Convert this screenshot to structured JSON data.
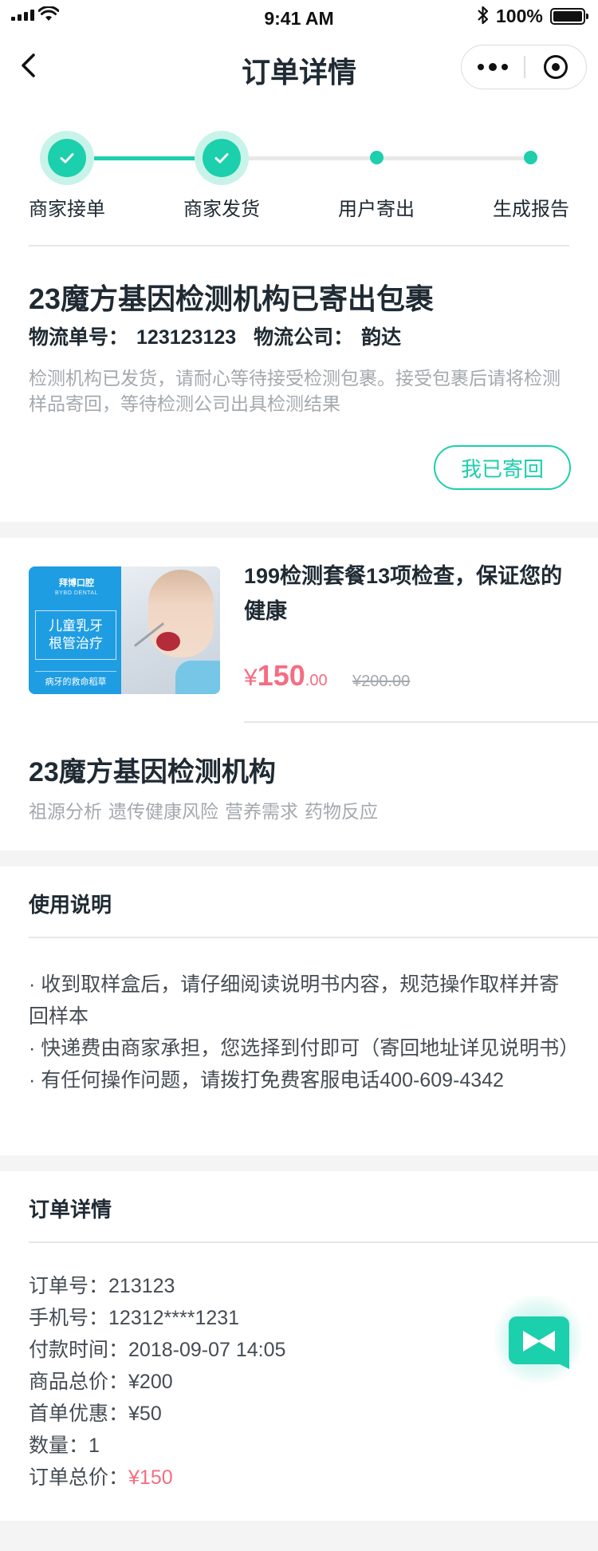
{
  "status_bar": {
    "time": "9:41 AM",
    "battery": "100%"
  },
  "nav": {
    "title": "订单详情"
  },
  "progress": {
    "steps": [
      {
        "label": "商家接单",
        "done": true
      },
      {
        "label": "商家发货",
        "done": true
      },
      {
        "label": "用户寄出",
        "done": false
      },
      {
        "label": "生成报告",
        "done": false
      }
    ]
  },
  "shipment": {
    "title": "23魔方基因检测机构已寄出包裹",
    "tracking_label": "物流单号：",
    "tracking_no": "123123123",
    "company_label": "物流公司：",
    "company": "韵达",
    "desc": "检测机构已发货，请耐心等待接受检测包裹。接受包裹后请将检测样品寄回，等待检测公司出具检测结果",
    "button": "我已寄回"
  },
  "product": {
    "thumb": {
      "brand": "拜博口腔",
      "brand_en": "BYBO DENTAL",
      "line1": "儿童乳牙",
      "line2": "根管治疗",
      "footer": "病牙的救命稻草"
    },
    "name": "199检测套餐13项检查，保证您的健康",
    "price_symbol": "¥",
    "price_int": "150",
    "price_dec": ".00",
    "price_old": "¥200.00"
  },
  "org": {
    "name": "23魔方基因检测机构",
    "tags": [
      "祖源分析",
      "遗传健康风险",
      "营养需求",
      "药物反应"
    ]
  },
  "usage": {
    "title": "使用说明",
    "items": [
      "· 收到取样盒后，请仔细阅读说明书内容，规范操作取样并寄回样本",
      "· 快递费由商家承担，您选择到付即可（寄回地址详见说明书）",
      "· 有任何操作问题，请拨打免费客服电话400-609-4342"
    ]
  },
  "order": {
    "title": "订单详情",
    "rows": [
      {
        "label": "订单号：",
        "value": "213123"
      },
      {
        "label": "手机号：",
        "value": "12312****1231"
      },
      {
        "label": "付款时间：",
        "value": "2018-09-07 14:05"
      },
      {
        "label": "商品总价：",
        "value": "¥200"
      },
      {
        "label": "首单优惠：",
        "value": "¥50"
      },
      {
        "label": "数量：",
        "value": "1"
      },
      {
        "label": "订单总价：",
        "value": "¥150"
      }
    ]
  },
  "colors": {
    "accent": "#1ccfad",
    "price": "#f56d82",
    "text": "#1f2a33",
    "muted": "#a3a9ae"
  },
  "icons": {
    "back": "chevron-left-icon",
    "more": "more-dots-icon",
    "close": "target-close-icon",
    "step_done": "check-icon",
    "service": "customer-service-icon"
  }
}
